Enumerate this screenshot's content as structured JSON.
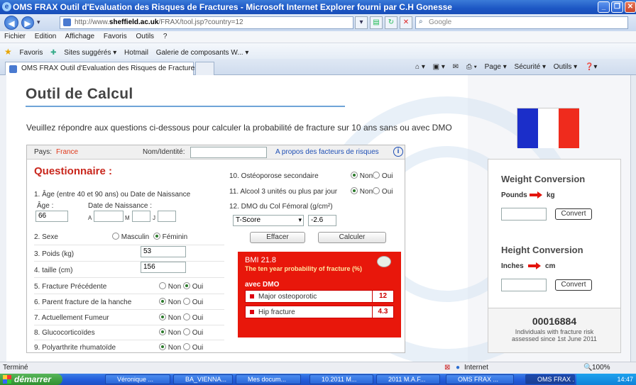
{
  "window": {
    "title": "OMS FRAX Outil d'Evaluation des Risques de Fractures - Microsoft Internet Explorer fourni par C.H Gonesse"
  },
  "address": {
    "prefix": "http://www.",
    "domain": "sheffield.ac.uk",
    "path": "/FRAX/tool.jsp?country=12",
    "search_placeholder": "Google"
  },
  "menu": [
    "Fichier",
    "Edition",
    "Affichage",
    "Favoris",
    "Outils",
    "?"
  ],
  "favorites": {
    "label": "Favoris",
    "items": [
      "Sites suggérés ▾",
      "Hotmail",
      "Galerie de composants W... ▾"
    ]
  },
  "tab": {
    "label": "OMS FRAX Outil d'Evaluation des Risques de Fractures"
  },
  "commands": [
    "Page ▾",
    "Sécurité ▾",
    "Outils ▾"
  ],
  "page": {
    "title": "Outil de Calcul",
    "intro": "Veuillez répondre aux questions ci-dessous pour calculer la probabilité de fracture sur 10 ans sans ou avec DMO",
    "country_label": "Pays:",
    "country_value": "France",
    "name_label": "Nom/Identité:",
    "name_value": "",
    "about_link": "A propos des facteurs de risques",
    "questionnaire": "Questionnaire :",
    "q1": "1. Âge (entre 40 et 90 ans) ou Date de Naissance",
    "age_label": "Âge :",
    "dob_label": "Date de Naissance :",
    "age_value": "66",
    "a_label": "A",
    "m_label": "M",
    "j_label": "J",
    "q2": "2. Sexe",
    "sex_male": "Masculin",
    "sex_female": "Féminin",
    "q3": "3. Poids (kg)",
    "weight_value": "53",
    "q4": "4. taille (cm)",
    "height_value": "156",
    "q5": "5. Fracture Précédente",
    "q6": "6. Parent fracture de la hanche",
    "q7": "7. Actuellement Fumeur",
    "q8": "8. Glucocorticoïdes",
    "q9": "9. Polyarthrite rhumatoïde",
    "q10": "10. Ostéoporose secondaire",
    "q11": "11. Alcool 3 unités ou plus par jour",
    "q12": "12. DMO du Col Fémoral (g/cm²)",
    "no": "Non",
    "yes": "Oui",
    "tscore_select": "T-Score",
    "tscore_value": "-2.6",
    "btn_clear": "Effacer",
    "btn_calc": "Calculer",
    "result": {
      "bmi": "BMI  21.8",
      "subtitle": "The ten year probability of fracture (%)",
      "with_bmd": "avec DMO",
      "major_label": "Major osteoporotic",
      "major_value": "12",
      "hip_label": "Hip fracture",
      "hip_value": "4.3"
    }
  },
  "conversion": {
    "weight_title": "Weight Conversion",
    "pounds": "Pounds",
    "kg": "kg",
    "height_title": "Height Conversion",
    "inches": "Inches",
    "cm": "cm",
    "convert": "Convert"
  },
  "counter": {
    "number": "00016884",
    "text1": "Individuals with fracture risk",
    "text2": "assessed since 1st June 2011"
  },
  "status": {
    "left": "Terminé",
    "zone": "Internet",
    "zoom": "100%"
  },
  "taskbar": {
    "start": "démarrer",
    "tasks": [
      "Véronique ...",
      "BA_VIENNA...",
      "Mes docum...",
      "10.2011 M...",
      "2011 M.A.F...",
      "OMS FRAX ...",
      "OMS FRAX ..."
    ],
    "clock": "14:47"
  },
  "colors": {
    "accent_red": "#e8170b",
    "link_blue": "#1f4fb5",
    "title_blue": "#1c56c4"
  }
}
